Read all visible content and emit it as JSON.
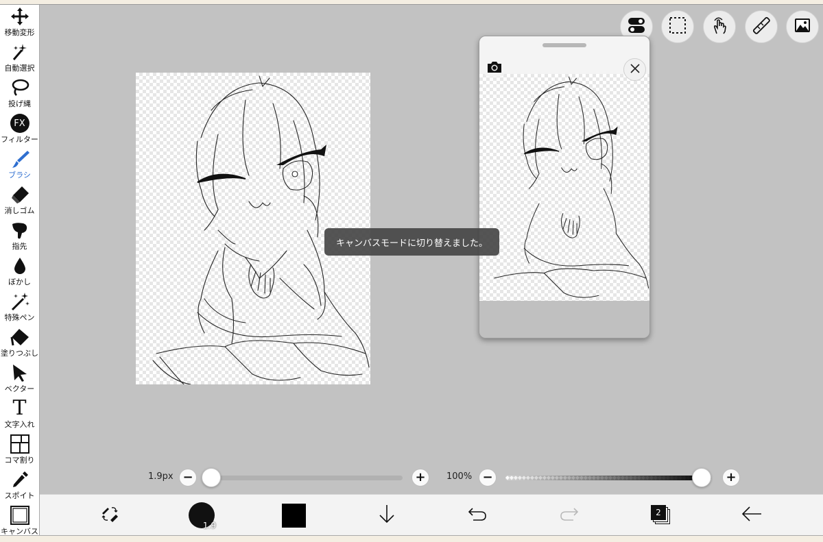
{
  "sidebar": {
    "tools": [
      {
        "label": "移動変形",
        "icon": "move-arrows-icon"
      },
      {
        "label": "自動選択",
        "icon": "magic-wand-icon"
      },
      {
        "label": "投げ縄",
        "icon": "lasso-icon"
      },
      {
        "label": "フィルター",
        "icon": "fx-icon",
        "glyph": "FX"
      },
      {
        "label": "ブラシ",
        "icon": "brush-icon",
        "active": true
      },
      {
        "label": "消しゴム",
        "icon": "eraser-icon"
      },
      {
        "label": "指先",
        "icon": "finger-smudge-icon"
      },
      {
        "label": "ぼかし",
        "icon": "blur-drop-icon"
      },
      {
        "label": "特殊ペン",
        "icon": "special-pen-icon"
      },
      {
        "label": "塗りつぶし",
        "icon": "paint-bucket-icon"
      },
      {
        "label": "ベクター",
        "icon": "vector-arrow-icon"
      },
      {
        "label": "文字入れ",
        "icon": "text-icon",
        "glyph": "T"
      },
      {
        "label": "コマ割り",
        "icon": "panel-divide-icon"
      },
      {
        "label": "スポイト",
        "icon": "eyedropper-icon"
      },
      {
        "label": "キャンバス",
        "icon": "canvas-icon"
      }
    ]
  },
  "top_buttons": [
    "toggle-icon",
    "selection-icon",
    "touch-gesture-icon",
    "ruler-icon",
    "image-icon"
  ],
  "toast": {
    "text": "キャンバスモードに切り替えました。"
  },
  "reference_window": {
    "camera_icon": "camera-icon",
    "close_icon": "close-icon"
  },
  "brush_size": {
    "label": "1.9px",
    "minus": "−",
    "plus": "+",
    "value": 0.0
  },
  "opacity": {
    "label": "100%",
    "minus": "−",
    "plus": "+",
    "value": 1.0
  },
  "bottom_toolbar": {
    "brush_size_badge": "1.9",
    "color": "#000000",
    "layer_count": "2"
  },
  "colors": {
    "accent": "#2f6fd0",
    "canvas_bg": "#c2c2c2",
    "toast_bg": "#464646"
  }
}
